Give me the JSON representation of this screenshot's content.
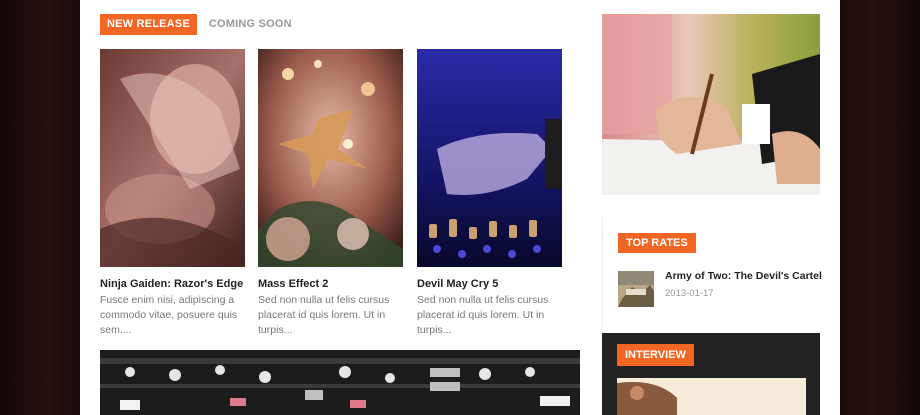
{
  "tabs": [
    {
      "label": "NEW RELEASE",
      "active": true
    },
    {
      "label": "COMING SOON",
      "active": false
    }
  ],
  "cards": [
    {
      "title": "Ninja Gaiden: Razor's Edge",
      "excerpt": "Fusce enim nisi, adipiscing a commodo vitae, posuere quis sem....",
      "image": "hands-photo"
    },
    {
      "title": "Mass Effect 2",
      "excerpt": "Sed non nulla ut felis cursus placerat id quis lorem. Ut in turpis...",
      "image": "christmas-ornament-photo"
    },
    {
      "title": "Devil May Cry 5",
      "excerpt": "Sed non nulla ut felis cursus placerat id quis lorem. Ut in turpis...",
      "image": "dj-mixer-photo"
    }
  ],
  "sidebar": {
    "top_rates": {
      "label": "TOP RATES",
      "items": [
        {
          "title": "Army of Two: The Devil's Cartel",
          "date": "2013-01-17"
        }
      ]
    },
    "interview": {
      "label": "INTERVIEW"
    }
  },
  "colors": {
    "accent": "#f26522",
    "text": "#222222",
    "muted": "#777777",
    "dark_panel": "#222222"
  }
}
